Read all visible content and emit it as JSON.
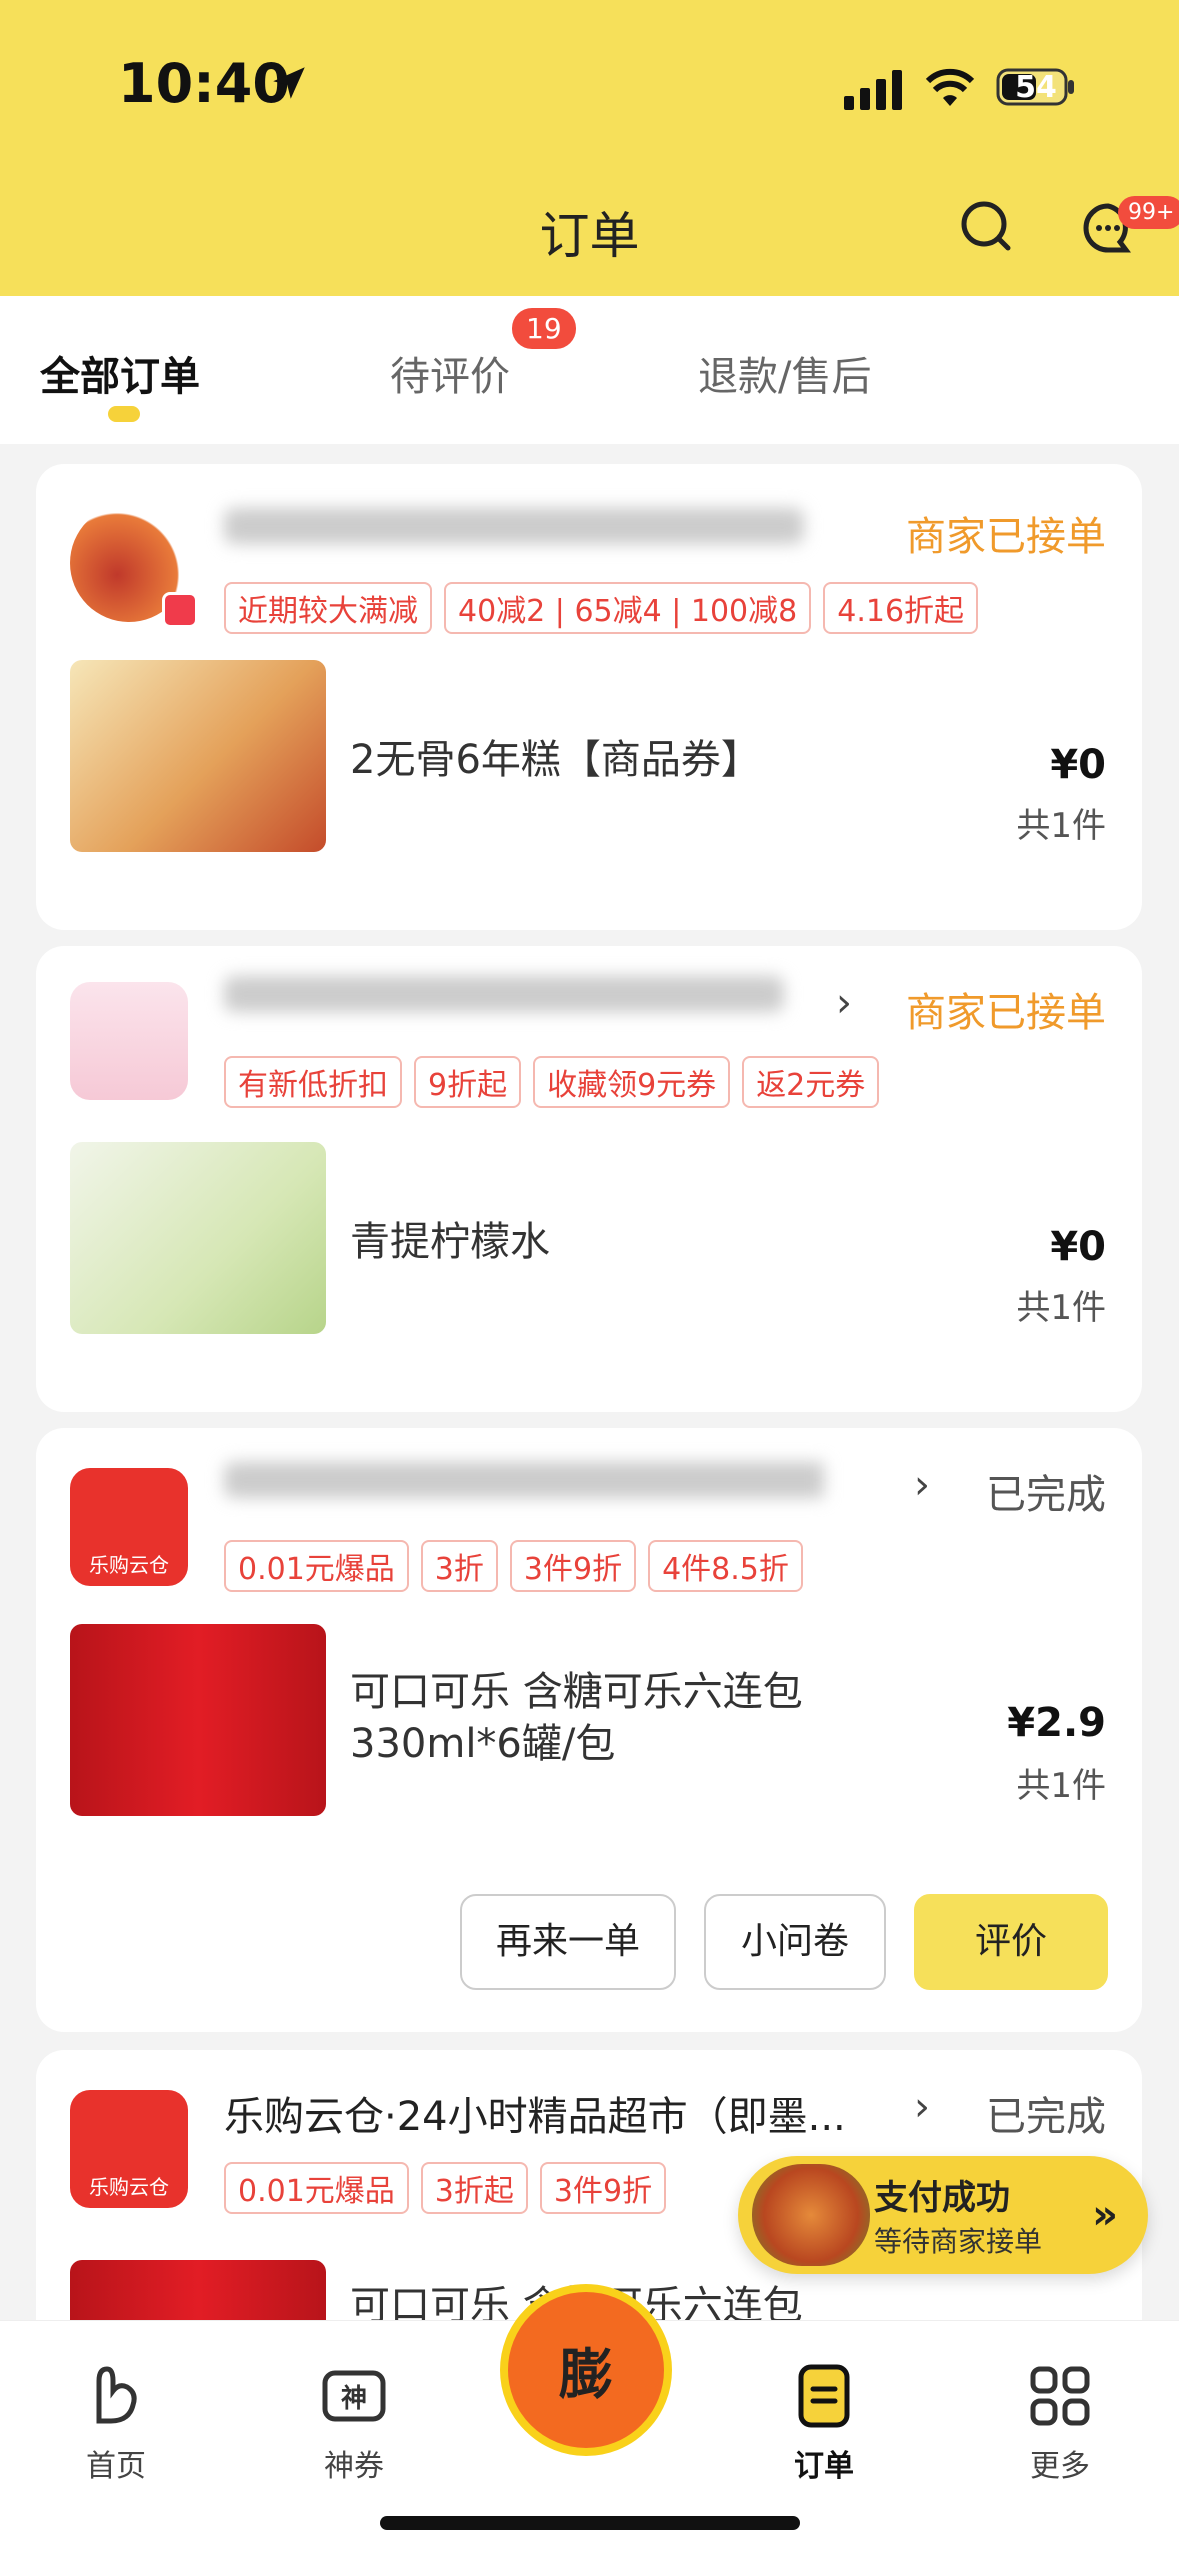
{
  "status_bar": {
    "time": "10:40",
    "battery": "54"
  },
  "header": {
    "title": "订单",
    "message_badge": "99+"
  },
  "tabs": [
    {
      "label": "全部订单",
      "active": true
    },
    {
      "label": "待评价",
      "badge": "19"
    },
    {
      "label": "退款/售后"
    }
  ],
  "orders": [
    {
      "store_name": "",
      "status": "商家已接单",
      "tags": [
        "近期较大满减",
        "40减2 | 65减4 | 100减8",
        "4.16折起"
      ],
      "product_name": "2无骨6年糕【商品券】",
      "price": "¥0",
      "qty": "共1件"
    },
    {
      "store_name": "",
      "status": "商家已接单",
      "tags": [
        "有新低折扣",
        "9折起",
        "收藏领9元券",
        "返2元券"
      ],
      "product_name": "青提柠檬水",
      "price": "¥0",
      "qty": "共1件"
    },
    {
      "store_name": "",
      "status": "已完成",
      "tags": [
        "0.01元爆品",
        "3折",
        "3件9折",
        "4件8.5折"
      ],
      "product_name": "可口可乐 含糖可乐六连包 330ml*6罐/包",
      "price": "¥2.9",
      "qty": "共1件",
      "buttons": [
        "再来一单",
        "小问卷",
        "评价"
      ]
    },
    {
      "store_name": "乐购云仓·24小时精品超市（即墨...",
      "status": "已完成",
      "tags": [
        "0.01元爆品",
        "3折起",
        "3件9折"
      ],
      "product_name": "可口可乐 含糖可乐六连包"
    }
  ],
  "toast": {
    "title": "支付成功",
    "subtitle": "等待商家接单",
    "arrow": "»"
  },
  "bottom_nav": [
    {
      "label": "首页",
      "icon": "home-rabbit-icon"
    },
    {
      "label": "神券",
      "icon": "coupon-icon"
    },
    {
      "label": "膨",
      "icon": "expand-coupon-icon"
    },
    {
      "label": "订单",
      "icon": "orders-icon",
      "active": true
    },
    {
      "label": "更多",
      "icon": "grid-icon"
    }
  ],
  "colors": {
    "accent": "#f6e05a",
    "status_orange": "#f09a2b",
    "tag_red": "#e8423a"
  }
}
